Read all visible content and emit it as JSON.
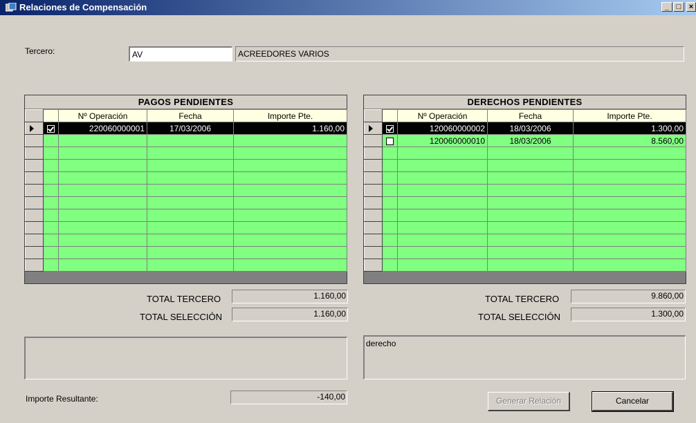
{
  "window": {
    "title": "Relaciones de Compensación",
    "controls": {
      "minimize": "_",
      "maximize": "□",
      "close": "×"
    }
  },
  "tercero": {
    "label": "Tercero:",
    "code": "AV",
    "name": "ACREEDORES VARIOS"
  },
  "pagos": {
    "title": "PAGOS PENDIENTES",
    "columns": [
      "Nº Operación",
      "Fecha",
      "Importe Pte."
    ],
    "rows": [
      {
        "checked": true,
        "operacion": "220060000001",
        "fecha": "17/03/2006",
        "importe": "1.160,00"
      }
    ],
    "total_tercero_label": "TOTAL TERCERO",
    "total_tercero": "1.160,00",
    "total_seleccion_label": "TOTAL SELECCIÓN",
    "total_seleccion": "1.160,00",
    "memo": ""
  },
  "derechos": {
    "title": "DERECHOS PENDIENTES",
    "columns": [
      "Nº Operación",
      "Fecha",
      "Importe Pte."
    ],
    "rows": [
      {
        "checked": true,
        "operacion": "120060000002",
        "fecha": "18/03/2006",
        "importe": "1.300,00"
      },
      {
        "checked": false,
        "operacion": "120060000010",
        "fecha": "18/03/2006",
        "importe": "8.560,00"
      }
    ],
    "total_tercero_label": "TOTAL TERCERO",
    "total_tercero": "9.860,00",
    "total_seleccion_label": "TOTAL SELECCIÓN",
    "total_seleccion": "1.300,00",
    "memo": "derecho"
  },
  "resultado": {
    "label": "Importe Resultante:",
    "value": "-140,00"
  },
  "buttons": {
    "generar": "Generar Relación",
    "cancelar": "Cancelar"
  }
}
